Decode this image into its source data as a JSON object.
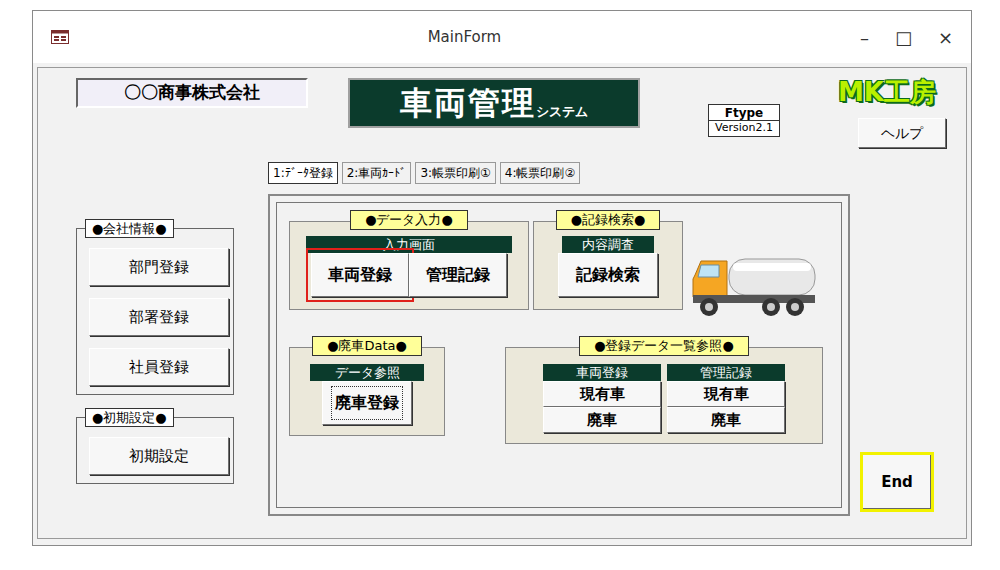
{
  "window": {
    "title": "MainForm",
    "controls": [
      "–",
      "□",
      "×"
    ]
  },
  "company": "〇〇商事株式会社",
  "app_title": {
    "main": "車両管理",
    "sub": "システム"
  },
  "version": {
    "type": "Ftype",
    "version": "Version2.1"
  },
  "logo": "MK工房",
  "help_button": "ヘルプ",
  "tabs": [
    {
      "label": "1:ﾃﾞｰﾀ登録",
      "selected": true
    },
    {
      "label": "2:車両ｶｰﾄﾞ",
      "selected": false
    },
    {
      "label": "3:帳票印刷①",
      "selected": false
    },
    {
      "label": "4:帳票印刷②",
      "selected": false
    }
  ],
  "sidebar": {
    "groups": [
      {
        "title": "●会社情報●",
        "buttons": [
          "部門登録",
          "部署登録",
          "社員登録"
        ]
      },
      {
        "title": "●初期設定●",
        "buttons": [
          "初期設定"
        ]
      }
    ]
  },
  "panel": {
    "data_entry": {
      "title": "●データ入力●",
      "header": "入力画面",
      "buttons": [
        {
          "label": "車両登録",
          "highlighted": true,
          "focused": false
        },
        {
          "label": "管理記録",
          "highlighted": false,
          "focused": false
        }
      ]
    },
    "search": {
      "title": "●記録検索●",
      "header": "内容調査",
      "buttons": [
        {
          "label": "記録検索",
          "highlighted": false,
          "focused": false
        }
      ]
    },
    "scrap": {
      "title": "●廃車Data●",
      "header": "データ参照",
      "buttons": [
        {
          "label": "廃車登録",
          "highlighted": false,
          "focused": true
        }
      ]
    },
    "list": {
      "title": "●登録データ一覧参照●",
      "columns": [
        {
          "header": "車両登録",
          "buttons": [
            "現有車",
            "廃車"
          ]
        },
        {
          "header": "管理記録",
          "buttons": [
            "現有車",
            "廃車"
          ]
        }
      ]
    }
  },
  "end_button": "End"
}
